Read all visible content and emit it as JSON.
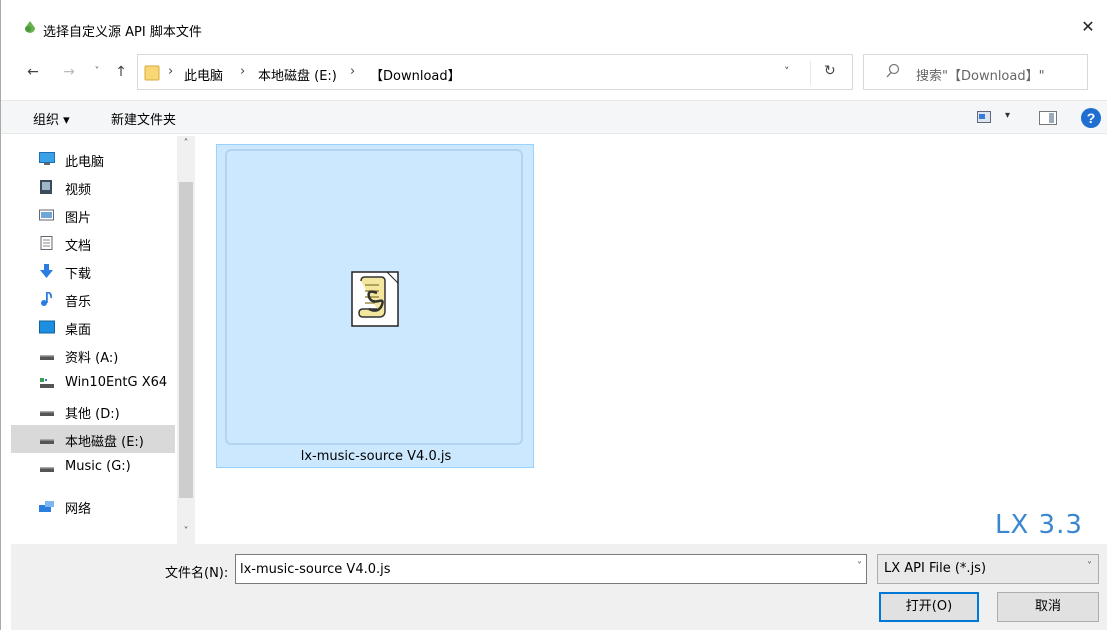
{
  "window": {
    "title": "选择自定义源 API 脚本文件",
    "close_glyph": "✕"
  },
  "address": {
    "back_glyph": "←",
    "forward_glyph": "→",
    "recent_glyph": "˅",
    "up_glyph": "↑",
    "crumbs": [
      "此电脑",
      "本地磁盘 (E:)",
      "【Download】"
    ],
    "separator": "›",
    "dropdown_glyph": "˅",
    "refresh_glyph": "↻"
  },
  "search": {
    "placeholder": "搜索\"【Download】\""
  },
  "toolbar": {
    "organize_label": "组织 ▾",
    "new_folder_label": "新建文件夹",
    "view_dropdown_glyph": "▾",
    "help_glyph": "?"
  },
  "nav": {
    "items": [
      {
        "label": "此电脑",
        "icon": "computer-icon"
      },
      {
        "label": "视频",
        "icon": "video-icon"
      },
      {
        "label": "图片",
        "icon": "pictures-icon"
      },
      {
        "label": "文档",
        "icon": "documents-icon"
      },
      {
        "label": "下载",
        "icon": "download-icon"
      },
      {
        "label": "音乐",
        "icon": "music-icon"
      },
      {
        "label": "桌面",
        "icon": "desktop-icon"
      },
      {
        "label": "资料 (A:)",
        "icon": "drive-icon"
      },
      {
        "label": "Win10EntG X64",
        "icon": "network-drive-icon"
      },
      {
        "label": "其他 (D:)",
        "icon": "drive-icon"
      },
      {
        "label": "本地磁盘 (E:)",
        "icon": "drive-icon",
        "selected": true
      },
      {
        "label": "Music (G:)",
        "icon": "drive-icon"
      },
      {
        "label": "网络",
        "icon": "network-icon"
      }
    ],
    "scroll_up_glyph": "˄",
    "scroll_down_glyph": "˅"
  },
  "content": {
    "file_name": "lx-music-source V4.0.js",
    "file_icon": "script-file-icon"
  },
  "watermark": "LX 3.3",
  "bottom": {
    "filename_label": "文件名(N):",
    "filename_value": "lx-music-source V4.0.js",
    "filename_dropdown_glyph": "˅",
    "filter_value": "LX API File (*.js)",
    "filter_dropdown_glyph": "˅",
    "open_label": "打开(O)",
    "cancel_label": "取消"
  },
  "colors": {
    "selection_bg": "#cce8ff",
    "selection_border": "#99d1ff",
    "accent": "#0078d7",
    "watermark": "#3a86d1"
  }
}
